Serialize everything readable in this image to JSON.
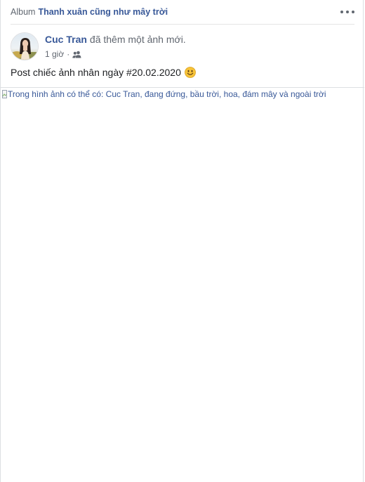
{
  "album": {
    "prefix": "Album",
    "name": "Thanh xuân cũng như mây trời"
  },
  "post": {
    "author": "Cuc Tran",
    "action": "đã thêm một ảnh mới.",
    "time": "1 giờ",
    "separator": "·",
    "privacy_icon": "friends-icon",
    "text": "Post chiếc ảnh nhân ngày #20.02.2020",
    "emoji": "smiley-emoji",
    "photo_alt": "Trong hình ảnh có thể có: Cuc Tran, đang đứng, bầu trời, hoa, đám mây và ngoài trời"
  },
  "colors": {
    "link": "#385898",
    "secondary_text": "#616770",
    "primary_text": "#1c1e21",
    "border": "#dddfe2"
  }
}
